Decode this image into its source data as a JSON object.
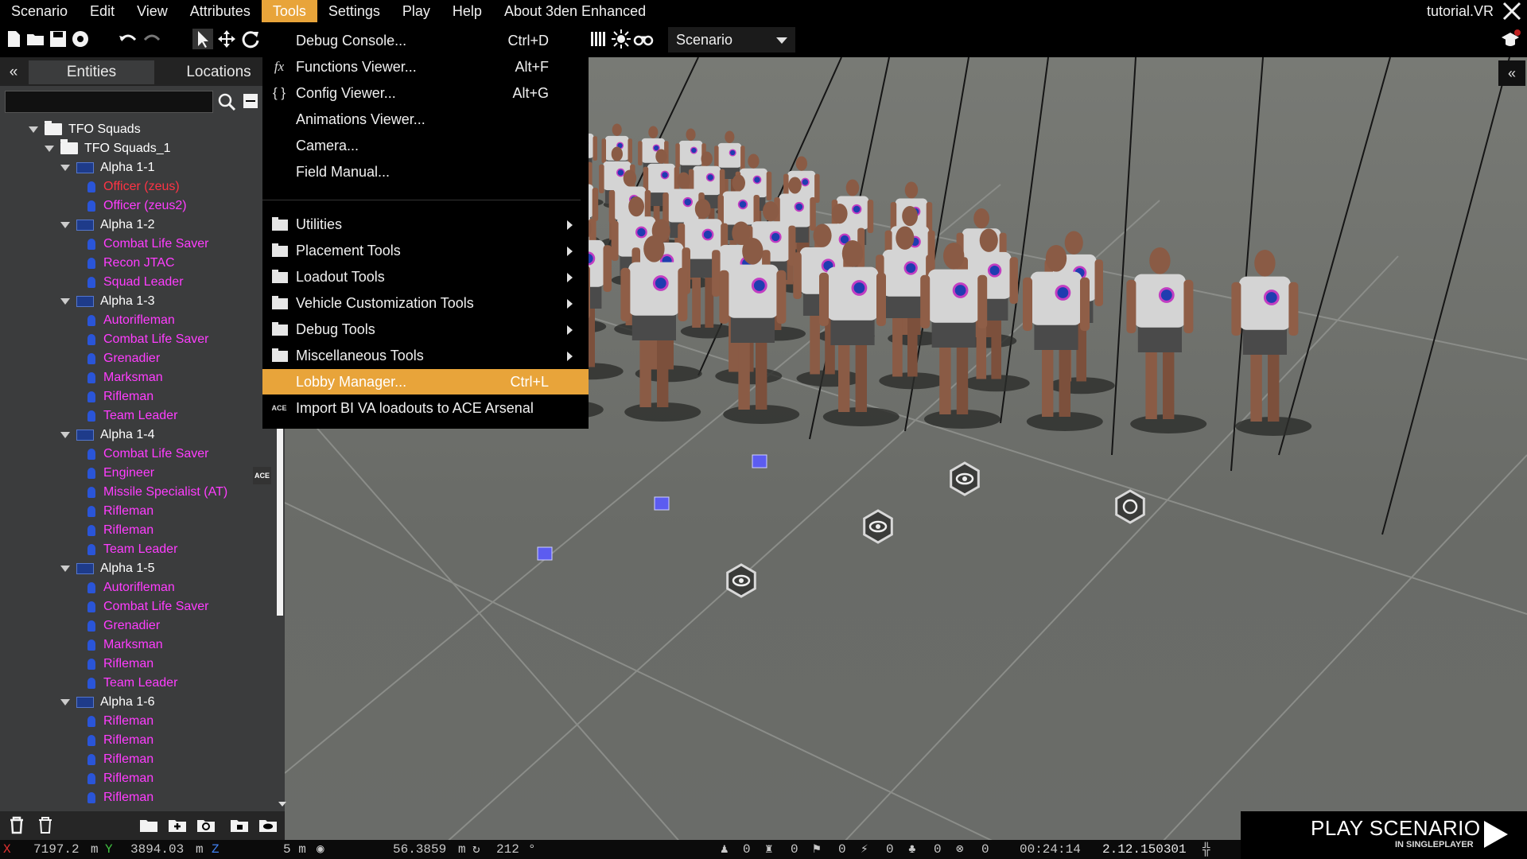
{
  "menubar": {
    "items": [
      "Scenario",
      "Edit",
      "View",
      "Attributes",
      "Tools",
      "Settings",
      "Play",
      "Help",
      "About 3den Enhanced"
    ],
    "active_index": 4,
    "mission_name": "tutorial.VR"
  },
  "toolbar": {
    "scenario_select": "Scenario"
  },
  "left_panel": {
    "collapse_label": "«",
    "tabs": [
      "Entities",
      "Locations"
    ],
    "search_placeholder": "",
    "tree": [
      {
        "type": "folder",
        "label": "TFO Squads",
        "depth": 0,
        "expanded": true
      },
      {
        "type": "folder",
        "label": "TFO Squads_1",
        "depth": 1,
        "expanded": true
      },
      {
        "type": "group",
        "label": "Alpha 1-1",
        "depth": 2
      },
      {
        "type": "unit",
        "label": "Officer (zeus)",
        "depth": 3,
        "color": "red"
      },
      {
        "type": "unit",
        "label": "Officer (zeus2)",
        "depth": 3
      },
      {
        "type": "group",
        "label": "Alpha 1-2",
        "depth": 2
      },
      {
        "type": "unit",
        "label": "Combat Life Saver",
        "depth": 3
      },
      {
        "type": "unit",
        "label": "Recon JTAC",
        "depth": 3
      },
      {
        "type": "unit",
        "label": "Squad Leader",
        "depth": 3
      },
      {
        "type": "group",
        "label": "Alpha 1-3",
        "depth": 2
      },
      {
        "type": "unit",
        "label": "Autorifleman",
        "depth": 3
      },
      {
        "type": "unit",
        "label": "Combat Life Saver",
        "depth": 3
      },
      {
        "type": "unit",
        "label": "Grenadier",
        "depth": 3
      },
      {
        "type": "unit",
        "label": "Marksman",
        "depth": 3
      },
      {
        "type": "unit",
        "label": "Rifleman",
        "depth": 3
      },
      {
        "type": "unit",
        "label": "Team Leader",
        "depth": 3
      },
      {
        "type": "group",
        "label": "Alpha 1-4",
        "depth": 2
      },
      {
        "type": "unit",
        "label": "Combat Life Saver",
        "depth": 3
      },
      {
        "type": "unit",
        "label": "Engineer",
        "depth": 3,
        "badge": "ACE"
      },
      {
        "type": "unit",
        "label": "Missile Specialist (AT)",
        "depth": 3
      },
      {
        "type": "unit",
        "label": "Rifleman",
        "depth": 3
      },
      {
        "type": "unit",
        "label": "Rifleman",
        "depth": 3
      },
      {
        "type": "unit",
        "label": "Team Leader",
        "depth": 3
      },
      {
        "type": "group",
        "label": "Alpha 1-5",
        "depth": 2
      },
      {
        "type": "unit",
        "label": "Autorifleman",
        "depth": 3
      },
      {
        "type": "unit",
        "label": "Combat Life Saver",
        "depth": 3
      },
      {
        "type": "unit",
        "label": "Grenadier",
        "depth": 3
      },
      {
        "type": "unit",
        "label": "Marksman",
        "depth": 3
      },
      {
        "type": "unit",
        "label": "Rifleman",
        "depth": 3
      },
      {
        "type": "unit",
        "label": "Team Leader",
        "depth": 3
      },
      {
        "type": "group",
        "label": "Alpha 1-6",
        "depth": 2
      },
      {
        "type": "unit",
        "label": "Rifleman",
        "depth": 3
      },
      {
        "type": "unit",
        "label": "Rifleman",
        "depth": 3
      },
      {
        "type": "unit",
        "label": "Rifleman",
        "depth": 3
      },
      {
        "type": "unit",
        "label": "Rifleman",
        "depth": 3
      },
      {
        "type": "unit",
        "label": "Rifleman",
        "depth": 3
      }
    ]
  },
  "tools_menu": {
    "items": [
      {
        "label": "Debug Console...",
        "shortcut": "Ctrl+D",
        "icon": ""
      },
      {
        "label": "Functions Viewer...",
        "shortcut": "Alt+F",
        "icon": "fx"
      },
      {
        "label": "Config Viewer...",
        "shortcut": "Alt+G",
        "icon": "{}"
      },
      {
        "label": "Animations Viewer...",
        "shortcut": "",
        "icon": ""
      },
      {
        "label": "Camera...",
        "shortcut": "",
        "icon": ""
      },
      {
        "label": "Field Manual...",
        "shortcut": "",
        "icon": ""
      },
      {
        "label": "Utilities",
        "shortcut": "",
        "icon": "folder",
        "submenu": true
      },
      {
        "label": "Placement Tools",
        "shortcut": "",
        "icon": "folder",
        "submenu": true
      },
      {
        "label": "Loadout Tools",
        "shortcut": "",
        "icon": "folder",
        "submenu": true
      },
      {
        "label": "Vehicle Customization Tools",
        "shortcut": "",
        "icon": "folder",
        "submenu": true
      },
      {
        "label": "Debug Tools",
        "shortcut": "",
        "icon": "folder",
        "submenu": true
      },
      {
        "label": "Miscellaneous Tools",
        "shortcut": "",
        "icon": "folder",
        "submenu": true
      },
      {
        "label": "Lobby Manager...",
        "shortcut": "Ctrl+L",
        "icon": "",
        "highlighted": true
      },
      {
        "label": "Import BI VA loadouts to ACE Arsenal",
        "shortcut": "",
        "icon": "ace"
      }
    ]
  },
  "statusbar": {
    "x_value": "7197.2",
    "x_unit": "m",
    "y_value": "3894.03",
    "y_unit": "m",
    "grid_value": "5 m",
    "distance": "56.3859",
    "distance_unit": "m",
    "rotation": "212",
    "rotation_unit": "°",
    "counts": [
      "0",
      "0",
      "0",
      "0",
      "0",
      "0"
    ],
    "time": "00:24:14",
    "version": "2.12.150301"
  },
  "play_button": {
    "title": "PLAY SCENARIO",
    "subtitle": "IN SINGLEPLAYER"
  },
  "colors": {
    "accent": "#e8a43a",
    "unit_label": "#ff3dff",
    "selected_unit": "#ff3344",
    "marker_ring": "#c23dc2"
  }
}
